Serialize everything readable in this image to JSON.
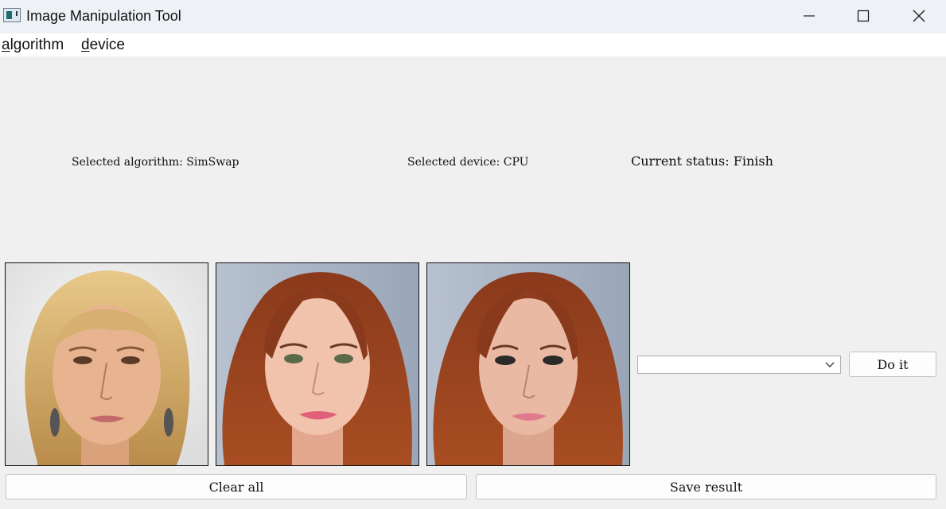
{
  "window": {
    "title": "Image Manipulation Tool"
  },
  "menu": {
    "algorithm": {
      "mnemonic": "a",
      "rest": "lgorithm"
    },
    "device": {
      "mnemonic": "d",
      "rest": "evice"
    }
  },
  "status": {
    "algorithm": "Selected algorithm: SimSwap",
    "device": "Selected device: CPU",
    "current": "Current status: Finish"
  },
  "images": {
    "source": "blonde woman portrait (source face)",
    "target": "red-haired woman portrait (target)",
    "result": "face-swapped result portrait"
  },
  "controls": {
    "combo_value": "",
    "do_it": "Do it",
    "clear_all": "Clear all",
    "save_result": "Save result"
  },
  "colors": {
    "titlebar": "#eef1f6",
    "background": "#f0f0f0",
    "menubar": "#ffffff"
  }
}
